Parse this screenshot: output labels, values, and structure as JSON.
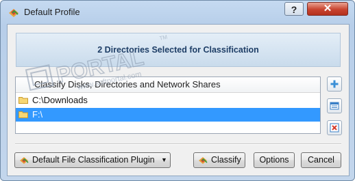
{
  "window": {
    "title": "Default Profile",
    "help_label": "?",
    "close_label": "✕"
  },
  "banner": {
    "text": "2 Directories Selected for Classification"
  },
  "list": {
    "header": "Classify Disks, Directories and Network Shares",
    "items": [
      {
        "label": "C:\\Downloads",
        "selected": false
      },
      {
        "label": "F:\\",
        "selected": true
      }
    ]
  },
  "side_buttons": [
    {
      "icon": "add-icon"
    },
    {
      "icon": "properties-icon"
    },
    {
      "icon": "remove-icon"
    }
  ],
  "footer": {
    "plugin_label": "Default File Classification Plugin",
    "dropdown_arrow": "▼",
    "classify_label": "Classify",
    "options_label": "Options",
    "cancel_label": "Cancel"
  },
  "watermark": {
    "brand": "PORTAL",
    "url": "www.softportal.com",
    "tm": "TM"
  },
  "colors": {
    "selection": "#3399ff",
    "banner_text": "#1e3e66",
    "close": "#c8432f"
  }
}
